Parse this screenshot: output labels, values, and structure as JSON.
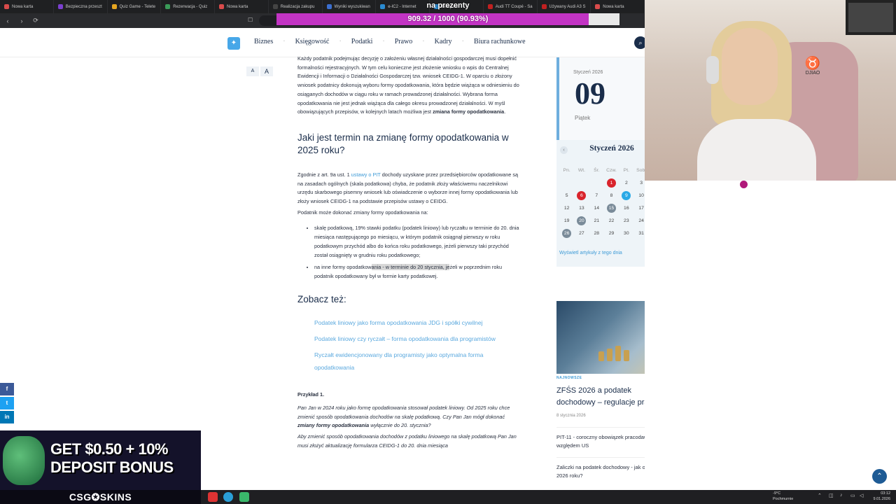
{
  "browser": {
    "tabs": [
      {
        "label": "Nowa karta",
        "color": "#d94b4b"
      },
      {
        "label": "Bezpieczna przeszt",
        "color": "#7b3fcf"
      },
      {
        "label": "Quiz Game - Telete",
        "color": "#e6a520"
      },
      {
        "label": "Rezerwacja - Quiz",
        "color": "#3a9a58"
      },
      {
        "label": "Nowa karta",
        "color": "#d94b4b"
      },
      {
        "label": "Realizacja zakupu",
        "color": "#444"
      },
      {
        "label": "Wyniki wyszukiwan",
        "color": "#3b6fcf"
      },
      {
        "label": "e-IC2 - Internet",
        "color": "#2a8ad0"
      },
      {
        "label": "Bilety na",
        "color": "#2a8ad0"
      },
      {
        "label": "Audi TT Coupé - Sa",
        "color": "#c02020"
      },
      {
        "label": "Używany Audi A3 S",
        "color": "#c02020"
      },
      {
        "label": "Nowa karta",
        "color": "#d94b4b"
      }
    ],
    "goal_title": "na prezenty",
    "goal_text": "909.32 / 1000 (90.93%)",
    "goal_fraction": 0.9093
  },
  "site": {
    "nav": [
      "Biznes",
      "Księgowość",
      "Podatki",
      "Prawo",
      "Kadry",
      "Biura rachunkowe"
    ],
    "font_small": "A",
    "font_big": "A"
  },
  "article": {
    "intro": "Każdy podatnik podejmując decyzję o założeniu własnej działalności gospodarczej musi dopełnić formalności rejestracyjnych. W tym celu konieczne jest złożenie wniosku o wpis do Centralnej Ewidencji i Informacji o Działalności Gospodarczej tzw. wniosek CEIDG-1. W oparciu o złożony wniosek podatnicy dokonują wyboru formy opodatkowania, która będzie wiążąca w odniesieniu do osiąganych dochodów w ciągu roku w ramach prowadzonej działalności. Wybrana forma opodatkowania nie jest jednak wiążąca dla całego okresu prowadzonej działalności. W myśl obowiązujących przepisów, w kolejnych latach możliwa jest",
    "intro_bold": "zmiana formy opodatkowania",
    "heading": "Jaki jest termin na zmianę formy opodatkowania w 2025 roku?",
    "p1_a": "Zgodnie z art. 9a ust. 1",
    "p1_link": "ustawy o PIT",
    "p1_b": "dochody uzyskane przez przedsiębiorców opodatkowane są na zasadach ogólnych (skala podatkowa) chyba, że podatnik złoży właściwemu naczelnikowi urzędu skarbowego pisemny wniosek lub oświadczenie o wyborze innej formy opodatkowania lub złoży wniosek CEIDG-1 na podstawie przepisów ustawy o CEIDG.",
    "p2": "Podatnik może dokonać zmiany formy opodatkowania na:",
    "li1": "skalę podatkową, 19% stawki podatku (podatek liniowy) lub ryczałtu w terminie do 20. dnia miesiąca następującego po miesiącu, w którym podatnik osiągnął pierwszy w roku podatkowym przychód albo do końca roku podatkowego, jeżeli pierwszy taki przychód został osiągnięty w grudniu roku podatkowego;",
    "li2_a": "na inne formy opodatkow",
    "li2_hl": "ania - w terminie do 20 stycznia, je",
    "li2_b": "żeli w poprzednim roku podatnik opodatkowany był w formie karty podatkowej.",
    "see_also": "Zobacz też:",
    "links": [
      "Podatek liniowy jako forma opodatkowania JDG i spółki cywilnej",
      "Podatek liniowy czy ryczałt – forma opodatkowania dla programistów",
      "Ryczałt ewidencjonowany dla programisty jako optymalna forma opodatkowania"
    ],
    "example_title": "Przykład 1.",
    "example_a": "Pan Jan w 2024 roku jako formę opodatkowania stosował podatek liniowy. Od 2025 roku chce zmienić sposób opodatkowania dochodów na skalę podatkową. Czy Pan Jan mógł dokonać",
    "example_bold": "zmiany formy opodatkowania",
    "example_b": "wyłącznie do 20. stycznia?",
    "example_c": "Aby zmienić sposób opodatkowania dochodów z podatku liniowego na skalę podatkową Pan Jan musi złożyć aktualizację formularza CEIDG-1 do 20. dnia miesiąca"
  },
  "sidebar": {
    "month": "Styczeń 2026",
    "day": "09",
    "weekday": "Piątek",
    "cal_title": "Styczeń 2026",
    "cal_prev": "‹",
    "weekdays": [
      "Pn.",
      "Wt.",
      "Śr.",
      "Czw.",
      "Pt.",
      "Sob."
    ],
    "days": [
      "",
      "",
      "",
      "1",
      "2",
      "3",
      "4",
      "5",
      "6",
      "7",
      "8",
      "9",
      "10",
      "11",
      "12",
      "13",
      "14",
      "15",
      "16",
      "17",
      "18",
      "19",
      "20",
      "21",
      "22",
      "23",
      "24",
      "25",
      "26",
      "27",
      "28",
      "29",
      "30",
      "31",
      ""
    ],
    "red_days": [
      "1",
      "6"
    ],
    "blue_days": [
      "9"
    ],
    "grey_days": [
      "15",
      "20",
      "26"
    ],
    "cal_link": "Wyświetl artykuły z tego dnia",
    "tag": "NAJNOWSZE",
    "promo_title": "ZFŚS 2026 a podatek dochodowy – regulacje prawne",
    "promo_date": "8 stycznia 2026",
    "link1": "PIT-11 - coroczny obowiązek pracodawcy względem US",
    "link2": "Zaliczki na podatek dochodowy - jak obliczyć w 2026 roku?"
  },
  "social": [
    {
      "glyph": "f",
      "color": "#3b5998"
    },
    {
      "glyph": "t",
      "color": "#1da1f2"
    },
    {
      "glyph": "in",
      "color": "#0077b5"
    }
  ],
  "ad": {
    "line1": "GET $0.50 + 10%",
    "line2": "DEPOSIT BONUS",
    "brand": "CSG✪SKINS"
  },
  "webcam": {
    "chair_brand": "DJIAO"
  },
  "taskbar": {
    "weather_temp": "-9°C",
    "weather_desc": "Pochmurnie",
    "time": "03:12",
    "date": "9.01.2026"
  }
}
